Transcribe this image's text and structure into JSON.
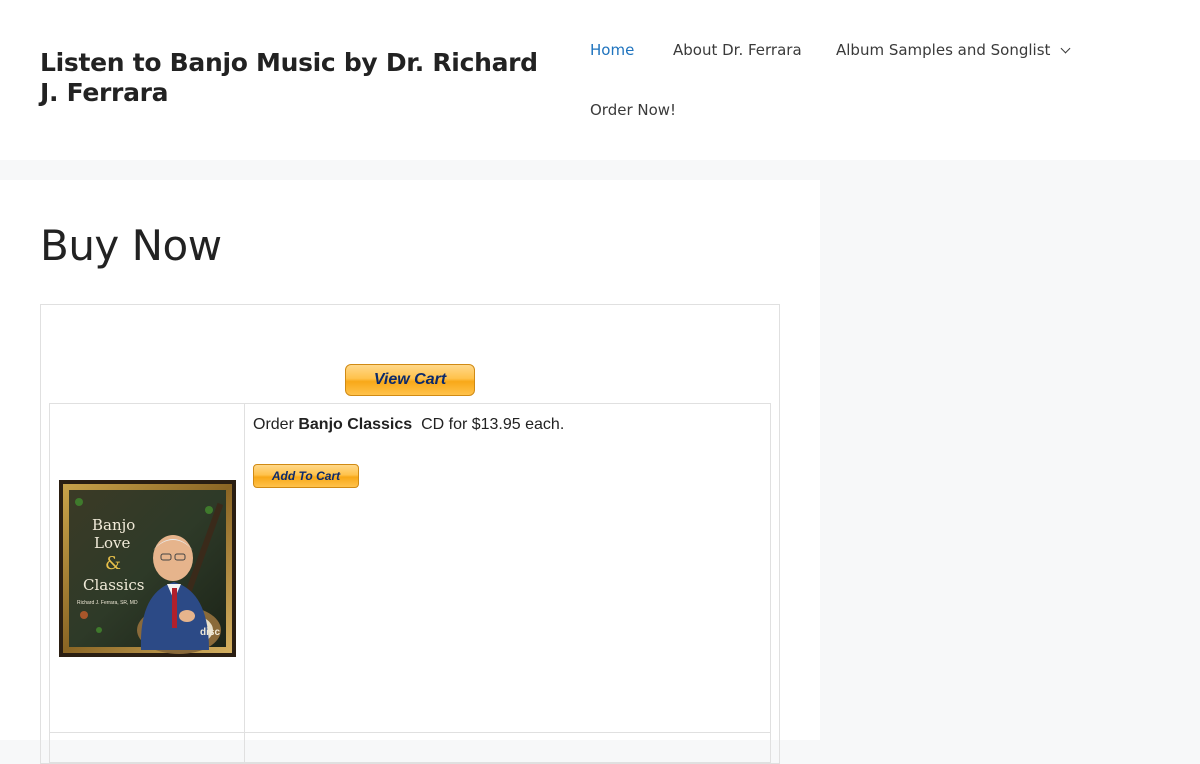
{
  "header": {
    "site_title": "Listen to Banjo Music by Dr. Richard J. Ferrara",
    "nav": {
      "home": "Home",
      "about": "About Dr. Ferrara",
      "album_samples": "Album Samples and Songlist",
      "order_now": "Order Now!"
    },
    "active_color": "#1e73be"
  },
  "main": {
    "page_title": "Buy Now",
    "view_cart_label": "View Cart",
    "product": {
      "order_prefix": "Order ",
      "name": "Banjo Classics",
      "order_suffix": "  CD for $13.95 each.",
      "add_to_cart_label": "Add To Cart",
      "cover": {
        "line1": "Banjo",
        "line2": "Love",
        "line3": "&",
        "line4": "Classics",
        "artist": "Richard J. Ferrara, SR, MD",
        "badge": "disc"
      }
    }
  },
  "icons": {
    "submenu": "chevron-down-icon"
  }
}
